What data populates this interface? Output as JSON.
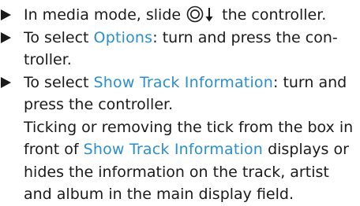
{
  "steps": [
    {
      "pre": "In media mode, slide",
      "icon": "controller-slide-down-icon",
      "post": "the controller."
    },
    {
      "pre": "To select ",
      "term": "Options",
      "post": ": turn and press the con-troller."
    },
    {
      "pre": "To select ",
      "term": "Show Track Information",
      "post": ": turn and press the controller."
    }
  ],
  "note": {
    "part1": "Ticking or removing the tick from the box in front of ",
    "term": "Show Track Information",
    "part2": " displays or hides the information on the track, artist and album in the main display field."
  },
  "colors": {
    "highlight": "#2a8fce",
    "text": "#1a1a1a"
  }
}
